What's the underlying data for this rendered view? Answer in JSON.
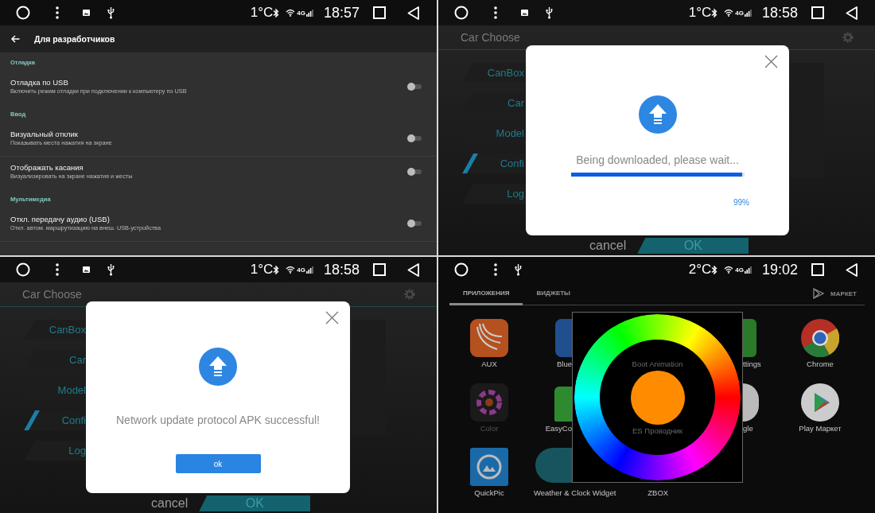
{
  "panels": [
    {
      "kind": "settings",
      "status_bar": {
        "temperature": "1°C",
        "network": "4G",
        "time": "18:57",
        "image_notification": true
      },
      "title": "Для разработчиков",
      "sections": [
        {
          "header": "Отладка",
          "items": [
            {
              "title": "Отладка по USB",
              "subtitle": "Включить режим отладки при подключении к компьютеру по USB",
              "on": false
            }
          ]
        },
        {
          "header": "Ввод",
          "items": [
            {
              "title": "Визуальный отклик",
              "subtitle": "Показывать места нажатия на экране",
              "on": false
            },
            {
              "title": "Отображать касания",
              "subtitle": "Визуализировать на экране нажатия и жесты",
              "on": false
            }
          ]
        },
        {
          "header": "Мультимедиа",
          "items": [
            {
              "title": "Откл. передачу аудио (USB)",
              "subtitle": "Откл. автом. маршрутизацию на внеш. USB-устройства",
              "on": false
            }
          ]
        }
      ]
    },
    {
      "kind": "progress_dialog",
      "status_bar": {
        "temperature": "1°C",
        "network": "4G",
        "time": "18:58",
        "image_notification": true
      },
      "app_title": "Car Choose",
      "menu": [
        {
          "label": "CanBox",
          "selected": false
        },
        {
          "label": "Car",
          "selected": false
        },
        {
          "label": "Model",
          "selected": false
        },
        {
          "label": "Confi",
          "selected": true
        },
        {
          "label": "Log",
          "selected": false
        }
      ],
      "footer_buttons": [
        "cancel",
        "OK"
      ],
      "dialog": {
        "message": "Being downloaded, please wait...",
        "level": 0.99,
        "percent": "99%"
      }
    },
    {
      "kind": "result_dialog",
      "status_bar": {
        "temperature": "1°C",
        "network": "4G",
        "time": "18:58",
        "image_notification": true
      },
      "app_title": "Car Choose",
      "menu": [
        {
          "label": "CanBox",
          "selected": false
        },
        {
          "label": "Car",
          "selected": false
        },
        {
          "label": "Model",
          "selected": false
        },
        {
          "label": "Confi",
          "selected": true
        },
        {
          "label": "Log",
          "selected": false
        }
      ],
      "footer_buttons": [
        "cancel",
        "OK"
      ],
      "dialog": {
        "message": "Network update protocol APK successful!",
        "button": "ok"
      }
    },
    {
      "kind": "launcher",
      "status_bar": {
        "temperature": "2°C",
        "network": "4G",
        "time": "19:02",
        "image_notification": false
      },
      "tabs": [
        {
          "label": "ПРИЛОЖЕНИЯ",
          "selected": true
        },
        {
          "label": "ВИДЖЕТЫ",
          "selected": false
        }
      ],
      "market": "МАРКЕТ",
      "apps_left": [
        {
          "label": "AUX",
          "kind": "aux"
        },
        {
          "label": "Color",
          "kind": "color"
        },
        {
          "label": "QuickPic",
          "kind": "quickpic"
        }
      ],
      "apps_partial_left": [
        {
          "label": "Blue",
          "kind": "bluetooth"
        },
        {
          "label": "EasyCo",
          "kind": "easyconnect"
        },
        {
          "kind": "weather"
        }
      ],
      "apps_under_wheel": [
        "Boot Animation",
        "ES Проводник"
      ],
      "apps_partial_right": [
        {
          "label": "ttings",
          "kind": "settings"
        },
        {
          "label": "gle",
          "kind": "google"
        }
      ],
      "apps_right": [
        {
          "label": "Chrome",
          "kind": "chrome"
        },
        {
          "label": "Play Маркет",
          "kind": "play"
        }
      ],
      "apps_bottom": [
        "Weather & Clock Widget",
        "ZBOX"
      ]
    }
  ]
}
